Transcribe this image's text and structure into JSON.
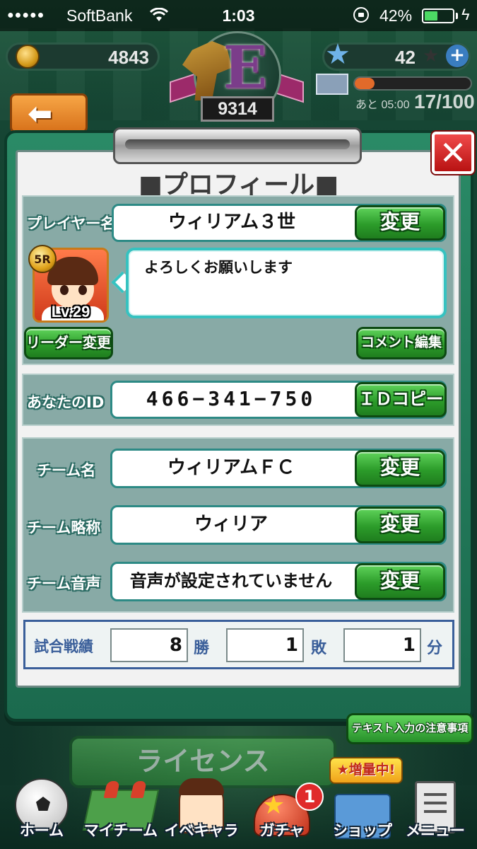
{
  "status_bar": {
    "signal": "●●●●●",
    "carrier": "SoftBank",
    "time": "1:03",
    "battery_text": "42%",
    "battery_level": 0.42
  },
  "hud": {
    "coins": "4843",
    "stars": "42",
    "plus": "+",
    "rank_letter": "E",
    "rank_score": "9314",
    "stamina_timer": "あと 05:00",
    "stamina_count": "17/100",
    "stamina_fill": 0.17
  },
  "dialog": {
    "title": "■プロフィール■",
    "close": "✕"
  },
  "player": {
    "name_label": "プレイヤー名",
    "name_value": "ウィリアム３世",
    "change_label": "変更",
    "avatar_rarity": "5R",
    "avatar_level": "Lv.29",
    "comment": "よろしくお願いします",
    "leader_change_label": "リーダー変更",
    "comment_edit_label": "コメント編集"
  },
  "id_section": {
    "label": "あなたのID",
    "value": "466−341−750",
    "copy_label": "ＩＤコピー"
  },
  "team": {
    "name_label": "チーム名",
    "name_value": "ウィリアムＦＣ",
    "abbr_label": "チーム略称",
    "abbr_value": "ウィリア",
    "voice_label": "チーム音声",
    "voice_value": "音声が設定されていません",
    "change_label": "変更"
  },
  "record": {
    "label": "試合戦績",
    "wins": "8",
    "wins_unit": "勝",
    "losses": "1",
    "losses_unit": "敗",
    "draws": "1",
    "draws_unit": "分"
  },
  "bottom": {
    "notice_label": "テキスト入力の注意事項",
    "license_label": "ライセンス",
    "shop_banner": "★増量中!",
    "gacha_badge": "1",
    "tabs": [
      {
        "label": "ホーム",
        "icon": "soccer-ball-icon"
      },
      {
        "label": "マイチーム",
        "icon": "team-field-icon"
      },
      {
        "label": "イベキャラ",
        "icon": "event-character-icon"
      },
      {
        "label": "ガチャ",
        "icon": "gacha-icon"
      },
      {
        "label": "ショップ",
        "icon": "shop-icon"
      },
      {
        "label": "メニュー",
        "icon": "menu-icon"
      }
    ]
  }
}
